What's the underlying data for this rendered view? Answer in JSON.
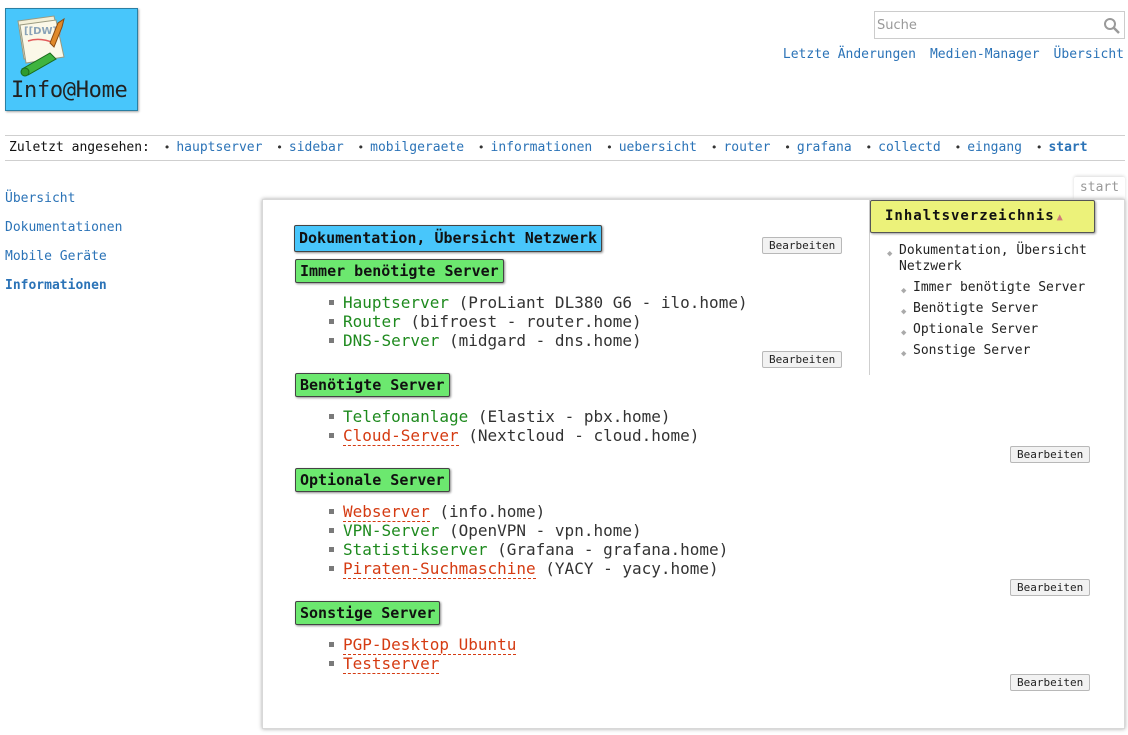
{
  "site": {
    "title": "Info@Home"
  },
  "search": {
    "placeholder": "Suche",
    "value": ""
  },
  "user_tools": [
    {
      "label": "Letzte Änderungen"
    },
    {
      "label": "Medien-Manager"
    },
    {
      "label": "Übersicht"
    }
  ],
  "breadcrumbs": {
    "label": "Zuletzt angesehen:",
    "items": [
      "hauptserver",
      "sidebar",
      "mobilgeraete",
      "informationen",
      "uebersicht",
      "router",
      "grafana",
      "collectd",
      "eingang",
      "start"
    ]
  },
  "sidebar": {
    "items": [
      {
        "label": "Übersicht"
      },
      {
        "label": "Dokumentationen"
      },
      {
        "label": "Mobile Geräte"
      },
      {
        "label": "Informationen"
      }
    ]
  },
  "page_id": "start",
  "content": {
    "title": "Dokumentation, Übersicht Netzwerk",
    "edit_label": "Bearbeiten",
    "sections": [
      {
        "title": "Immer benötigte Server",
        "items": [
          {
            "link": "Hauptserver",
            "desc": " (ProLiant DL380 G6 - ilo.home)",
            "exists": true
          },
          {
            "link": "Router",
            "desc": " (bifroest - router.home)",
            "exists": true
          },
          {
            "link": "DNS-Server",
            "desc": " (midgard - dns.home)",
            "exists": true
          }
        ]
      },
      {
        "title": "Benötigte Server",
        "items": [
          {
            "link": "Telefonanlage",
            "desc": " (Elastix - pbx.home)",
            "exists": true
          },
          {
            "link": "Cloud-Server",
            "desc": " (Nextcloud - cloud.home)",
            "exists": false
          }
        ]
      },
      {
        "title": "Optionale Server",
        "items": [
          {
            "link": "Webserver",
            "desc": " (info.home)",
            "exists": false
          },
          {
            "link": "VPN-Server",
            "desc": " (OpenVPN - vpn.home)",
            "exists": true
          },
          {
            "link": "Statistikserver",
            "desc": " (Grafana - grafana.home)",
            "exists": true
          },
          {
            "link": "Piraten-Suchmaschine",
            "desc": " (YACY - yacy.home)",
            "exists": false
          }
        ]
      },
      {
        "title": "Sonstige Server",
        "items": [
          {
            "link": "PGP-Desktop Ubuntu",
            "desc": "",
            "exists": false
          },
          {
            "link": "Testserver",
            "desc": "",
            "exists": false
          }
        ]
      }
    ]
  },
  "toc": {
    "title": "Inhaltsverzeichnis",
    "toggle": "▲",
    "top": "Dokumentation, Übersicht Netzwerk",
    "items": [
      "Immer benötigte Server",
      "Benötigte Server",
      "Optionale Server",
      "Sonstige Server"
    ]
  },
  "colors": {
    "logo_bg": "#48c6fb",
    "h1_bg": "#48c6fb",
    "h2_bg": "#6ce86f",
    "toc_bg": "#ecf27a",
    "link": "#2b73b7",
    "existing_page_link": "#1e8a1e",
    "missing_page_link": "#d53b12"
  }
}
